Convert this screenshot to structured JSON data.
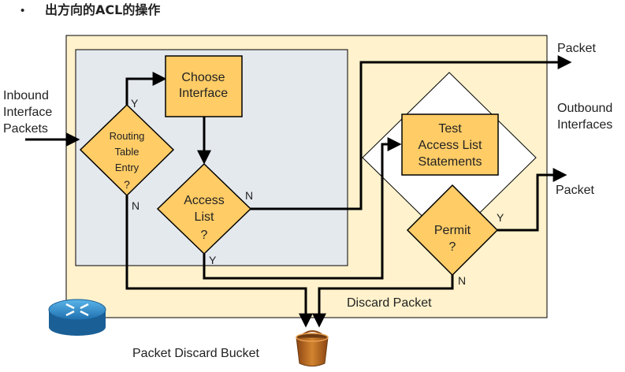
{
  "title": {
    "bullet": "•",
    "prefix": "出方向的",
    "acl": "ACL",
    "suffix": "的操作"
  },
  "inputs": {
    "inbound": [
      "Inbound",
      "Interface",
      "Packets"
    ]
  },
  "decisions": {
    "routing_table": [
      "Routing",
      "Table",
      "Entry",
      "?"
    ],
    "access_list": [
      "Access",
      "List",
      "?"
    ],
    "permit": [
      "Permit",
      "?"
    ]
  },
  "processes": {
    "choose_interface": [
      "Choose",
      "Interface"
    ],
    "test_acl": [
      "Test",
      "Access List",
      "Statements"
    ]
  },
  "branch_labels": {
    "routing_yes": "Y",
    "routing_no": "N",
    "access_no": "N",
    "access_yes": "Y",
    "permit_yes": "Y",
    "permit_no": "N"
  },
  "outputs": {
    "packet_top": "Packet",
    "packet_bottom": "Packet",
    "outbound": [
      "Outbound",
      "Interfaces"
    ],
    "discard": "Discard Packet",
    "bucket": "Packet Discard Bucket"
  },
  "colors": {
    "outer_box": "#FFF2CC",
    "inner_box": "#E4E9EE",
    "shape_fill": "#FFCC66",
    "line": "#000000",
    "router": "#2E8FD0",
    "bucket": "#B5651D"
  }
}
